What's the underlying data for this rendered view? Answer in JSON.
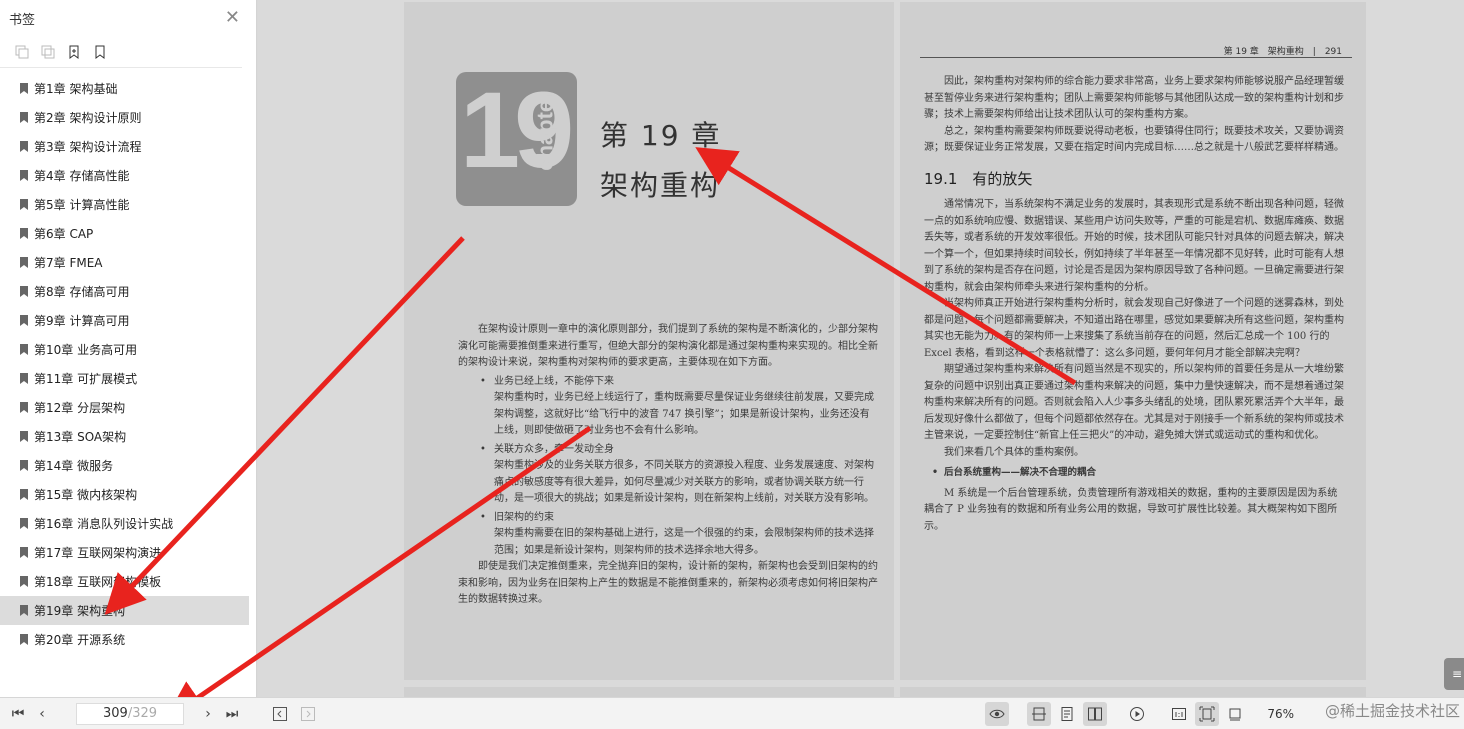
{
  "sidebar": {
    "title": "书签",
    "items": [
      {
        "label": "第1章 架构基础"
      },
      {
        "label": "第2章 架构设计原则"
      },
      {
        "label": "第3章 架构设计流程"
      },
      {
        "label": "第4章 存储高性能"
      },
      {
        "label": "第5章 计算高性能"
      },
      {
        "label": "第6章 CAP"
      },
      {
        "label": "第7章 FMEA"
      },
      {
        "label": "第8章 存储高可用"
      },
      {
        "label": "第9章 计算高可用"
      },
      {
        "label": "第10章 业务高可用"
      },
      {
        "label": "第11章 可扩展模式"
      },
      {
        "label": "第12章 分层架构"
      },
      {
        "label": "第13章 SOA架构"
      },
      {
        "label": "第14章 微服务"
      },
      {
        "label": "第15章 微内核架构"
      },
      {
        "label": "第16章 消息队列设计实战"
      },
      {
        "label": "第17章 互联网架构演进"
      },
      {
        "label": "第18章 互联网架构模板"
      },
      {
        "label": "第19章 架构重构"
      },
      {
        "label": "第20章 开源系统"
      }
    ],
    "active_index": 18
  },
  "left_page": {
    "chapter_number": "19",
    "chapter_word": "chapter",
    "title": "第 19 章",
    "subtitle": "架构重构",
    "intro": "在架构设计原则一章中的演化原则部分，我们提到了系统的架构是不断演化的，少部分架构演化可能需要推倒重来进行重写，但绝大部分的架构演化都是通过架构重构来实现的。相比全新的架构设计来说，架构重构对架构师的要求更高，主要体现在如下方面。",
    "b1_title": "业务已经上线，不能停下来",
    "b1_body": "架构重构时，业务已经上线运行了，重构既需要尽量保证业务继续往前发展，又要完成架构调整，这就好比“给飞行中的波音 747 换引擎”；如果是新设计架构，业务还没有上线，则即使做砸了对业务也不会有什么影响。",
    "b2_title": "关联方众多，牵一发动全身",
    "b2_body": "架构重构涉及的业务关联方很多，不同关联方的资源投入程度、业务发展速度、对架构痛点的敏感度等有很大差异，如何尽量减少对关联方的影响，或者协调关联方统一行动，是一项很大的挑战；如果是新设计架构，则在新架构上线前，对关联方没有影响。",
    "b3_title": "旧架构的约束",
    "b3_body": "架构重构需要在旧的架构基础上进行，这是一个很强的约束，会限制架构师的技术选择范围；如果是新设计架构，则架构师的技术选择余地大得多。",
    "outro": "即使是我们决定推倒重来，完全抛弃旧的架构，设计新的架构，新架构也会受到旧架构的约束和影响，因为业务在旧架构上产生的数据是不能推倒重来的，新架构必须考虑如何将旧架构产生的数据转换过来。"
  },
  "right_page": {
    "running_head": "第 19 章　架构重构　|　291",
    "p1": "因此，架构重构对架构师的综合能力要求非常高，业务上要求架构师能够说服产品经理暂缓甚至暂停业务来进行架构重构；团队上需要架构师能够与其他团队达成一致的架构重构计划和步骤；技术上需要架构师给出让技术团队认可的架构重构方案。",
    "p2": "总之，架构重构需要架构师既要说得动老板，也要镇得住同行；既要技术攻关，又要协调资源；既要保证业务正常发展，又要在指定时间内完成目标……总之就是十八般武艺要样样精通。",
    "section": "19.1　有的放矢",
    "p3": "通常情况下，当系统架构不满足业务的发展时，其表现形式是系统不断出现各种问题，轻微一点的如系统响应慢、数据错误、某些用户访问失败等，严重的可能是宕机、数据库瘫痪、数据丢失等，或者系统的开发效率很低。开始的时候，技术团队可能只针对具体的问题去解决，解决一个算一个，但如果持续时间较长，例如持续了半年甚至一年情况都不见好转，此时可能有人想到了系统的架构是否存在问题，讨论是否是因为架构原因导致了各种问题。一旦确定需要进行架构重构，就会由架构师牵头来进行架构重构的分析。",
    "p4": "当架构师真正开始进行架构重构分析时，就会发现自己好像进了一个问题的迷雾森林，到处都是问题，每个问题都需要解决，不知道出路在哪里，感觉如果要解决所有这些问题，架构重构其实也无能为力。有的架构师一上来搜集了系统当前存在的问题，然后汇总成一个 100 行的 Excel 表格，看到这样一个表格就懵了：这么多问题，要何年何月才能全部解决完啊？",
    "p5": "期望通过架构重构来解决所有问题当然是不现实的，所以架构师的首要任务是从一大堆纷繁复杂的问题中识别出真正要通过架构重构来解决的问题，集中力量快速解决，而不是想着通过架构重构来解决所有的问题。否则就会陷入人少事多头绪乱的处境，团队累死累活弄个大半年，最后发现好像什么都做了，但每个问题都依然存在。尤其是对于刚接手一个新系统的架构师或技术主管来说，一定要控制住“新官上任三把火”的冲动，避免摊大饼式或运动式的重构和优化。",
    "p6": "我们来看几个具体的重构案例。",
    "sub": "后台系统重构——解决不合理的耦合",
    "p7": "M 系统是一个后台管理系统，负责管理所有游戏相关的数据，重构的主要原因是因为系统耦合了 P 业务独有的数据和所有业务公用的数据，导致可扩展性比较差。其大概架构如下图所示。"
  },
  "bottombar": {
    "current_page": "309",
    "total_pages": "/329",
    "zoom": "76%",
    "watermark": "@稀土掘金技术社区"
  },
  "side_tab": "≡",
  "colors": {
    "arrow": "#e8231e",
    "active_item": "#dcdcdc"
  },
  "icons": [
    "close-icon",
    "expand-icon",
    "collapse-icon",
    "add-bookmark-icon",
    "bookmark-icon",
    "first-page-icon",
    "prev-page-icon",
    "next-page-icon",
    "last-page-icon",
    "eye-icon",
    "fit-width-icon",
    "single-page-icon",
    "double-page-icon",
    "play-icon",
    "actual-size-icon",
    "fit-page-icon",
    "rotate-icon"
  ]
}
